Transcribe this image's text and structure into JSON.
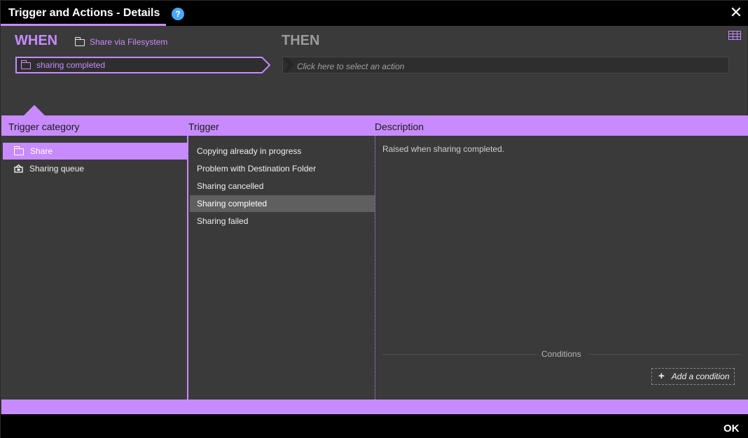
{
  "window": {
    "title": "Trigger and Actions - Details",
    "help_label": "?",
    "close_label": "✕"
  },
  "when": {
    "label": "WHEN",
    "source": "Share via Filesystem",
    "selected_trigger": "sharing completed"
  },
  "then": {
    "label": "THEN",
    "action_placeholder": "Click here to select an action"
  },
  "columns": {
    "category_header": "Trigger category",
    "trigger_header": "Trigger",
    "description_header": "Description"
  },
  "categories": [
    {
      "label": "Share",
      "icon": "folder-icon",
      "selected": true
    },
    {
      "label": "Sharing queue",
      "icon": "sharing-queue-icon",
      "selected": false
    }
  ],
  "triggers": [
    {
      "label": "Copying already in progress",
      "selected": false
    },
    {
      "label": "Problem with Destination Folder",
      "selected": false
    },
    {
      "label": "Sharing cancelled",
      "selected": false
    },
    {
      "label": "Sharing completed",
      "selected": true
    },
    {
      "label": "Sharing failed",
      "selected": false
    }
  ],
  "description": {
    "text": "Raised when sharing completed.",
    "conditions_label": "Conditions",
    "add_condition_label": "Add a condition"
  },
  "footer": {
    "ok_label": "OK"
  },
  "colors": {
    "accent": "#c88bff",
    "help": "#4aa8ff",
    "background": "#3a3a3a",
    "bar": "#000000"
  }
}
